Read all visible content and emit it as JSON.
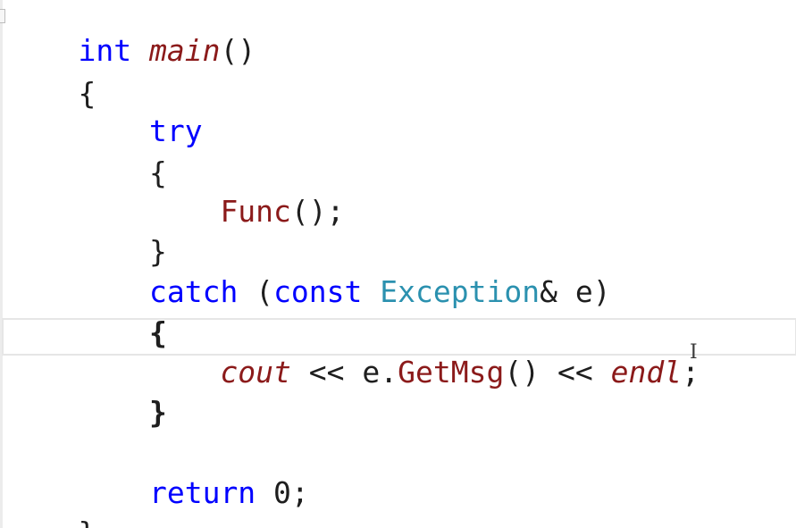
{
  "code": {
    "line1": {
      "kw": "int",
      "sp": " ",
      "fn": "main",
      "punc": "()"
    },
    "line2": {
      "punc": "{"
    },
    "line3": {
      "indent": "    ",
      "kw": "try"
    },
    "line4": {
      "indent": "    ",
      "punc": "{"
    },
    "line5": {
      "indent": "        ",
      "fn": "Func",
      "punc": "();"
    },
    "line6": {
      "indent": "    ",
      "punc": "}"
    },
    "line7": {
      "indent": "    ",
      "kw1": "catch",
      "p1": " (",
      "kw2": "const",
      "sp": " ",
      "type": "Exception",
      "p2": "& e)"
    },
    "line8": {
      "indent": "    ",
      "punc": "{"
    },
    "line9": {
      "indent": "        ",
      "cout": "cout",
      "p1": " << e.",
      "fn": "GetMsg",
      "p2": "() << ",
      "endl": "endl",
      "p3": ";"
    },
    "line10": {
      "indent": "    ",
      "punc": "}"
    },
    "line11": {
      "text": ""
    },
    "line12": {
      "indent": "    ",
      "kw": "return",
      "p": " 0;"
    },
    "line13": {
      "punc": "}"
    }
  },
  "cursor": {
    "glyph": "I"
  },
  "colors": {
    "keyword": "#0000ff",
    "function": "#8b1a1a",
    "type": "#2b91af",
    "text": "#1e1e1e",
    "background": "#ffffff"
  }
}
